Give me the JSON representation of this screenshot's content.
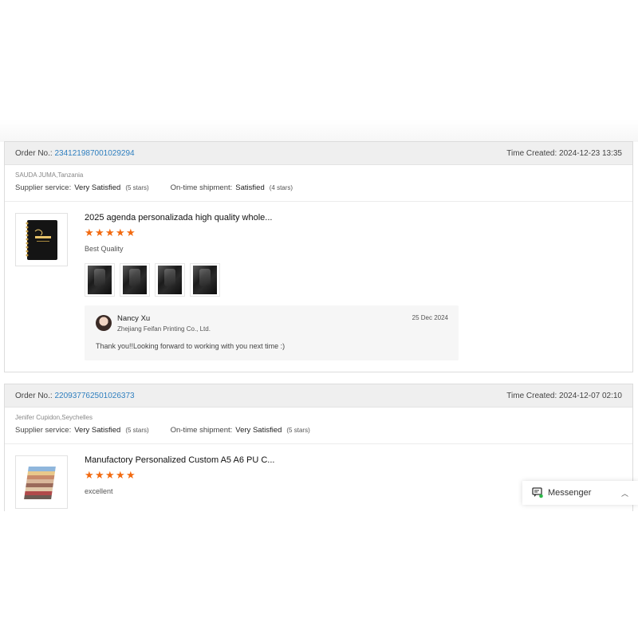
{
  "orders": [
    {
      "order_no_label": "Order No.:",
      "order_no": "234121987001029294",
      "time_created": "Time Created: 2024-12-23 13:35",
      "buyer": "SAUDA JUMA,Tanzania",
      "supplier_service_label": "Supplier service:",
      "supplier_service_value": "Very Satisfied",
      "supplier_service_stars": "(5 stars)",
      "shipment_label": "On-time shipment:",
      "shipment_value": "Satisfied",
      "shipment_stars": "(4 stars)",
      "product_title": "2025 agenda personalizada high quality whole...",
      "rating": 5,
      "review_text": "Best Quality",
      "photo_count": 4,
      "reply": {
        "name": "Nancy Xu",
        "company": "Zhejiang Feifan Printing Co., Ltd.",
        "date": "25 Dec 2024",
        "text": "Thank you!!Looking forward to working with you next time :)"
      }
    },
    {
      "order_no_label": "Order No.:",
      "order_no": "220937762501026373",
      "time_created": "Time Created: 2024-12-07 02:10",
      "buyer": "Jenifer Cupidon,Seychelles",
      "supplier_service_label": "Supplier service:",
      "supplier_service_value": "Very Satisfied",
      "supplier_service_stars": "(5 stars)",
      "shipment_label": "On-time shipment:",
      "shipment_value": "Very Satisfied",
      "shipment_stars": "(5 stars)",
      "product_title": "Manufactory Personalized Custom A5 A6 PU C...",
      "rating": 5,
      "review_text": "excellent"
    }
  ],
  "messenger": {
    "label": "Messenger",
    "icon": "chat-icon",
    "accent": "#2db84a"
  },
  "colors": {
    "star": "#f26a10",
    "link": "#2f7fbf"
  }
}
